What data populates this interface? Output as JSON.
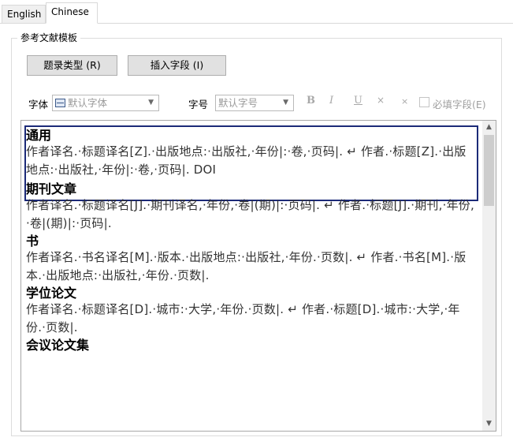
{
  "tabs": [
    {
      "label": "English",
      "active": false
    },
    {
      "label": "Chinese",
      "active": true
    }
  ],
  "group": {
    "legend": "参考文献模板"
  },
  "buttons": {
    "type": "题录类型 (R)",
    "insert": "插入字段 (I)"
  },
  "format": {
    "font_label": "字体",
    "font_value": "默认字体",
    "size_label": "字号",
    "size_value": "默认字号",
    "bold": "B",
    "italic": "I",
    "underline": "U",
    "superscript": "×",
    "subscript": "×",
    "required_label": "必填字段(E)"
  },
  "entries": [
    {
      "title": "通用",
      "body": "作者译名.·标题译名[Z].·出版地点:·出版社,·年份|:·卷,·页码|. ↵ 作者.·标题[Z].·出版地点:·出版社,·年份|:·卷,·页码|. DOI",
      "selected": true
    },
    {
      "title": "期刊文章",
      "body": "作者译名.·标题译名[J].·期刊译名,·年份,·卷|(期)|:·页码|. ↵ 作者.·标题[J].·期刊,·年份,·卷|(期)|:·页码|.",
      "selected": false
    },
    {
      "title": "书",
      "body": "作者译名.·书名译名[M].·版本.·出版地点:·出版社,·年份.·页数|. ↵ 作者.·书名[M].·版本.·出版地点:·出版社,·年份.·页数|.",
      "selected": false
    },
    {
      "title": "学位论文",
      "body": "作者译名.·标题译名[D].·城市:·大学,·年份.·页数|. ↵ 作者.·标题[D].·城市:·大学,·年份.·页数|.",
      "selected": false
    },
    {
      "title": "会议论文集",
      "body": "",
      "selected": false
    }
  ],
  "scrollbar": {
    "position_fraction": 0.0
  }
}
